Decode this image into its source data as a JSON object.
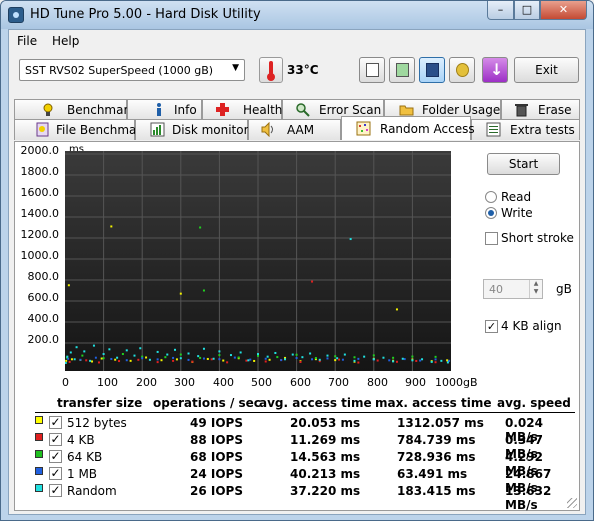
{
  "window": {
    "title": "HD Tune Pro 5.00 - Hard Disk Utility",
    "min": "–",
    "max": "□",
    "close": "✕"
  },
  "menu": {
    "file": "File",
    "help": "Help"
  },
  "toolbar": {
    "drive": "SST    RVS02 SuperSpeed (1000 gB)",
    "temperature": "33°C",
    "exit": "Exit",
    "icons": [
      "copy-text-icon",
      "copy-screenshot-icon",
      "save-icon",
      "options-icon",
      "download-icon"
    ]
  },
  "tabs_top": [
    "Benchmark",
    "Info",
    "Health",
    "Error Scan",
    "Folder Usage",
    "Erase"
  ],
  "tabs_bottom": [
    "File Benchmark",
    "Disk monitor",
    "AAM",
    "Random Access",
    "Extra tests"
  ],
  "active_tab": "Random Access",
  "side": {
    "start": "Start",
    "read": "Read",
    "write": "Write",
    "selected_mode": "Write",
    "short_stroke": "Short stroke",
    "short_stroke_checked": false,
    "stroke_value": "40",
    "stroke_unit": "gB",
    "align_4kb": "4 KB align",
    "align_checked": true
  },
  "chart_data": {
    "type": "scatter",
    "ylabel": "ms",
    "y_ticks": [
      "2000.0",
      "1800.0",
      "1600.0",
      "1400.0",
      "1200.0",
      "1000.0",
      "800.0",
      "600.0",
      "400.0",
      "200.0"
    ],
    "x_ticks": [
      "0",
      "100",
      "200",
      "300",
      "400",
      "500",
      "600",
      "700",
      "800",
      "900",
      "1000gB"
    ],
    "xlim": [
      0,
      1000
    ],
    "ylim": [
      0,
      2000
    ],
    "grid": true,
    "series": [
      {
        "name": "512 bytes",
        "color": "#f2f200",
        "points": [
          [
            3,
            30
          ],
          [
            18,
            45
          ],
          [
            40,
            38
          ],
          [
            70,
            24
          ],
          [
            95,
            52
          ],
          [
            130,
            41
          ],
          [
            170,
            30
          ],
          [
            210,
            62
          ],
          [
            250,
            36
          ],
          [
            290,
            44
          ],
          [
            330,
            20
          ],
          [
            370,
            48
          ],
          [
            410,
            33
          ],
          [
            450,
            55
          ],
          [
            490,
            29
          ],
          [
            530,
            40
          ],
          [
            570,
            58
          ],
          [
            610,
            26
          ],
          [
            650,
            46
          ],
          [
            700,
            37
          ],
          [
            750,
            22
          ],
          [
            800,
            50
          ],
          [
            850,
            31
          ],
          [
            900,
            43
          ],
          [
            950,
            27
          ],
          [
            990,
            35
          ],
          [
            120,
            1310
          ],
          [
            860,
            520
          ],
          [
            300,
            670
          ],
          [
            10,
            750
          ]
        ]
      },
      {
        "name": "4 KB",
        "color": "#e02020",
        "points": [
          [
            12,
            20
          ],
          [
            55,
            35
          ],
          [
            88,
            15
          ],
          [
            140,
            28
          ],
          [
            190,
            40
          ],
          [
            240,
            18
          ],
          [
            280,
            30
          ],
          [
            330,
            22
          ],
          [
            380,
            45
          ],
          [
            420,
            16
          ],
          [
            470,
            32
          ],
          [
            520,
            24
          ],
          [
            560,
            38
          ],
          [
            610,
            19
          ],
          [
            660,
            27
          ],
          [
            710,
            42
          ],
          [
            760,
            14
          ],
          [
            810,
            33
          ],
          [
            860,
            21
          ],
          [
            910,
            29
          ],
          [
            960,
            17
          ],
          [
            640,
            785
          ]
        ]
      },
      {
        "name": "64 KB",
        "color": "#20d020",
        "points": [
          [
            5,
            60
          ],
          [
            45,
            80
          ],
          [
            100,
            55
          ],
          [
            150,
            95
          ],
          [
            200,
            70
          ],
          [
            260,
            65
          ],
          [
            300,
            90
          ],
          [
            350,
            58
          ],
          [
            400,
            85
          ],
          [
            450,
            62
          ],
          [
            500,
            78
          ],
          [
            550,
            66
          ],
          [
            600,
            88
          ],
          [
            650,
            57
          ],
          [
            700,
            74
          ],
          [
            750,
            64
          ],
          [
            800,
            82
          ],
          [
            850,
            59
          ],
          [
            900,
            71
          ],
          [
            960,
            68
          ],
          [
            360,
            700
          ],
          [
            350,
            1300
          ]
        ]
      },
      {
        "name": "1 MB",
        "color": "#2060e0",
        "points": [
          [
            8,
            50
          ],
          [
            40,
            40
          ],
          [
            80,
            60
          ],
          [
            120,
            48
          ],
          [
            160,
            36
          ],
          [
            200,
            55
          ],
          [
            240,
            44
          ],
          [
            280,
            58
          ],
          [
            320,
            39
          ],
          [
            360,
            52
          ],
          [
            400,
            46
          ],
          [
            440,
            61
          ],
          [
            480,
            42
          ],
          [
            520,
            50
          ],
          [
            560,
            37
          ],
          [
            600,
            57
          ],
          [
            640,
            45
          ],
          [
            680,
            53
          ],
          [
            720,
            41
          ],
          [
            760,
            49
          ],
          [
            800,
            43
          ],
          [
            840,
            35
          ],
          [
            880,
            47
          ],
          [
            920,
            33
          ],
          [
            960,
            44
          ],
          [
            995,
            30
          ]
        ]
      },
      {
        "name": "Random",
        "color": "#20e0e0",
        "points": [
          [
            2,
            10
          ],
          [
            6,
            70
          ],
          [
            15,
            110
          ],
          [
            25,
            45
          ],
          [
            30,
            160
          ],
          [
            50,
            120
          ],
          [
            65,
            30
          ],
          [
            75,
            175
          ],
          [
            100,
            95
          ],
          [
            115,
            140
          ],
          [
            135,
            60
          ],
          [
            160,
            130
          ],
          [
            180,
            80
          ],
          [
            195,
            150
          ],
          [
            220,
            40
          ],
          [
            240,
            115
          ],
          [
            265,
            90
          ],
          [
            285,
            135
          ],
          [
            300,
            55
          ],
          [
            320,
            100
          ],
          [
            345,
            75
          ],
          [
            360,
            145
          ],
          [
            385,
            50
          ],
          [
            400,
            120
          ],
          [
            430,
            85
          ],
          [
            455,
            110
          ],
          [
            475,
            35
          ],
          [
            500,
            95
          ],
          [
            525,
            70
          ],
          [
            545,
            105
          ],
          [
            570,
            45
          ],
          [
            590,
            90
          ],
          [
            615,
            65
          ],
          [
            635,
            100
          ],
          [
            660,
            40
          ],
          [
            680,
            80
          ],
          [
            705,
            55
          ],
          [
            725,
            90
          ],
          [
            750,
            30
          ],
          [
            775,
            70
          ],
          [
            800,
            45
          ],
          [
            825,
            60
          ],
          [
            850,
            25
          ],
          [
            875,
            50
          ],
          [
            900,
            35
          ],
          [
            925,
            45
          ],
          [
            950,
            20
          ],
          [
            975,
            30
          ],
          [
            992,
            15
          ],
          [
            740,
            1190
          ]
        ]
      }
    ]
  },
  "results": {
    "headers": [
      "transfer size",
      "operations / sec",
      "avg. access time",
      "max. access time",
      "avg. speed"
    ],
    "rows": [
      {
        "size": "512 bytes",
        "color": "#ffff00",
        "ops": "49 IOPS",
        "avg": "20.053 ms",
        "max": "1312.057 ms",
        "speed": "0.024 MB/s"
      },
      {
        "size": "4 KB",
        "color": "#e02020",
        "ops": "88 IOPS",
        "avg": "11.269 ms",
        "max": "784.739 ms",
        "speed": "0.347 MB/s"
      },
      {
        "size": "64 KB",
        "color": "#20c020",
        "ops": "68 IOPS",
        "avg": "14.563 ms",
        "max": "728.936 ms",
        "speed": "4.292 MB/s"
      },
      {
        "size": "1 MB",
        "color": "#2060e0",
        "ops": "24 IOPS",
        "avg": "40.213 ms",
        "max": "63.491 ms",
        "speed": "24.867 MB/s"
      },
      {
        "size": "Random",
        "color": "#20e0e0",
        "ops": "26 IOPS",
        "avg": "37.220 ms",
        "max": "183.415 ms",
        "speed": "13.632 MB/s"
      }
    ]
  }
}
